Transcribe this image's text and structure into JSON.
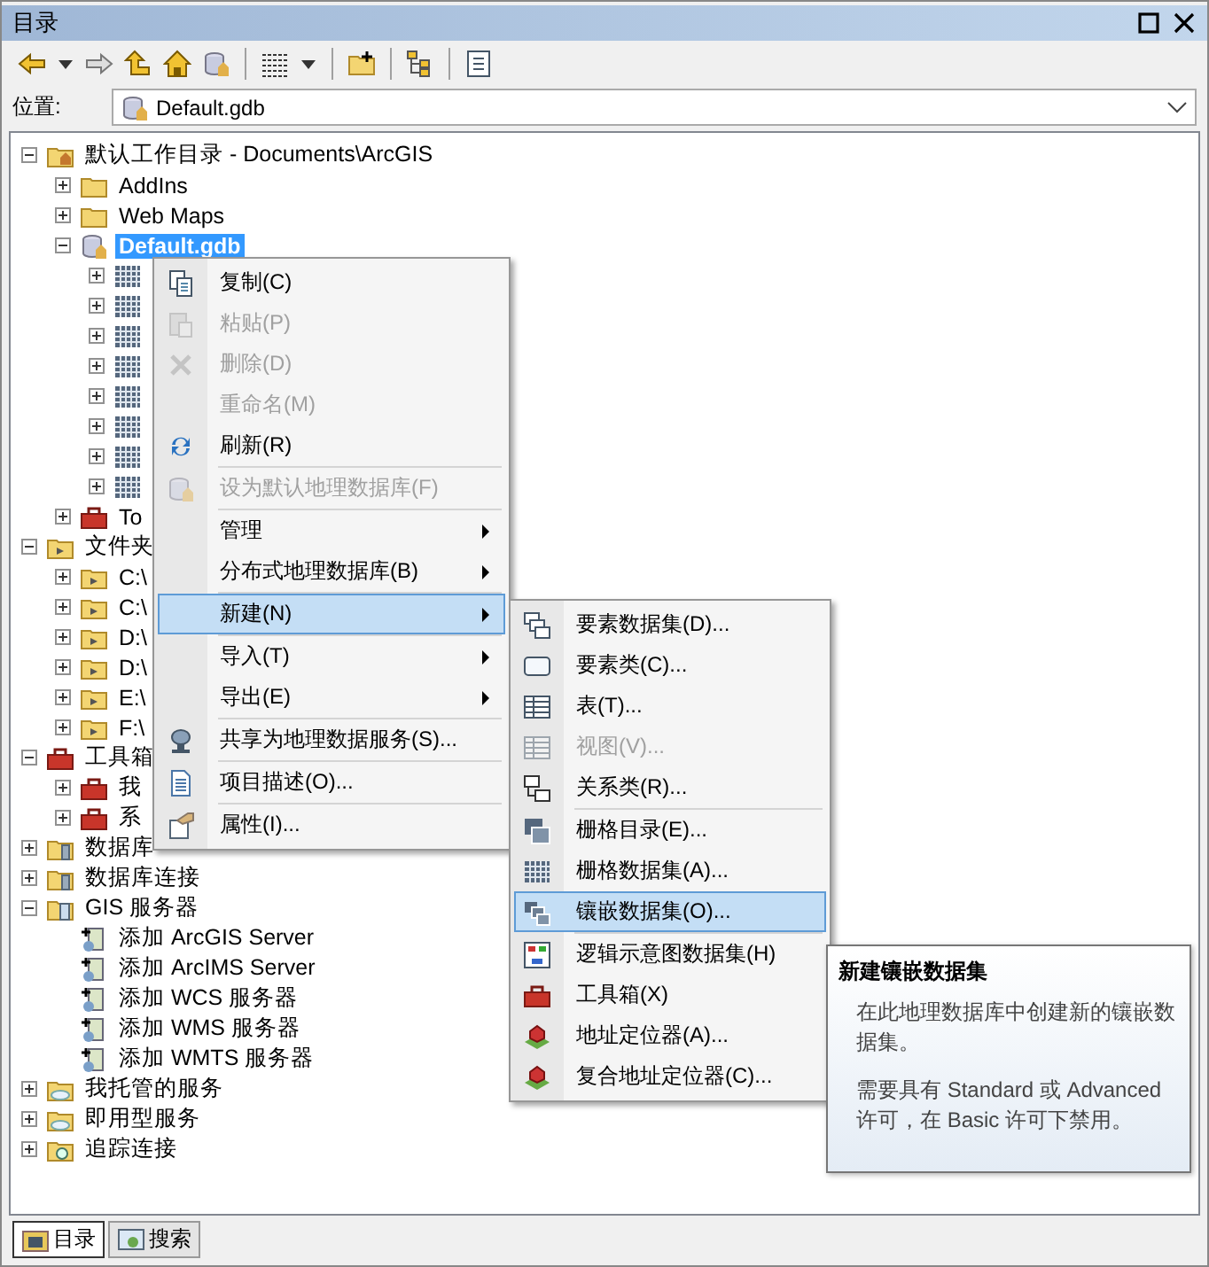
{
  "window": {
    "title": "目录"
  },
  "toolbar": {
    "buttons": [
      {
        "kind": "back"
      },
      {
        "kind": "dropdown"
      },
      {
        "kind": "forward"
      },
      {
        "kind": "up"
      },
      {
        "kind": "home"
      },
      {
        "kind": "gdb"
      },
      {
        "kind": "separator"
      },
      {
        "kind": "grid"
      },
      {
        "kind": "dropdown"
      },
      {
        "kind": "separator"
      },
      {
        "kind": "connect"
      },
      {
        "kind": "separator"
      },
      {
        "kind": "tree"
      },
      {
        "kind": "separator"
      },
      {
        "kind": "list"
      }
    ]
  },
  "location": {
    "label": "位置:",
    "value": "Default.gdb"
  },
  "tree": [
    {
      "label": "默认工作目录 - Documents\\ArcGIS",
      "kind": "home-folder",
      "expanded": true,
      "selected": false,
      "children": [
        {
          "label": "AddIns",
          "kind": "folder",
          "expanded": false,
          "selected": false
        },
        {
          "label": "Web Maps",
          "kind": "folder",
          "expanded": false,
          "selected": false
        },
        {
          "label": "Default.gdb",
          "kind": "gdb",
          "expanded": true,
          "selected": true,
          "children": [
            {
              "kind": "raster",
              "expanded": false
            },
            {
              "kind": "raster",
              "expanded": false
            },
            {
              "kind": "raster",
              "expanded": false
            },
            {
              "kind": "raster",
              "expanded": false
            },
            {
              "kind": "raster",
              "expanded": false
            },
            {
              "kind": "raster",
              "expanded": false
            },
            {
              "kind": "raster",
              "expanded": false
            },
            {
              "kind": "raster",
              "expanded": false
            }
          ]
        },
        {
          "label": "To",
          "kind": "toolbox",
          "expanded": false,
          "selected": false
        }
      ]
    },
    {
      "label": "文件夹",
      "kind": "folder-link",
      "expanded": true,
      "selected": false,
      "children": [
        {
          "label": "C:\\",
          "kind": "folder-link",
          "expanded": false,
          "selected": false
        },
        {
          "label": "C:\\",
          "kind": "folder-link",
          "expanded": false,
          "selected": false
        },
        {
          "label": "D:\\",
          "kind": "folder-link",
          "expanded": false,
          "selected": false
        },
        {
          "label": "D:\\",
          "kind": "folder-link",
          "expanded": false,
          "selected": false
        },
        {
          "label": "E:\\",
          "kind": "folder-link",
          "expanded": false,
          "selected": false
        },
        {
          "label": "F:\\",
          "kind": "folder-link",
          "expanded": false,
          "selected": false
        }
      ]
    },
    {
      "label": "工具箱",
      "kind": "toolbox",
      "expanded": true,
      "selected": false,
      "children": [
        {
          "label": "我",
          "kind": "toolbox",
          "expanded": false,
          "selected": false
        },
        {
          "label": "系",
          "kind": "toolbox",
          "expanded": false,
          "selected": false
        }
      ]
    },
    {
      "label": "数据库",
      "kind": "db-folder",
      "expanded": false,
      "selected": false
    },
    {
      "label": "数据库连接",
      "kind": "db-folder",
      "expanded": false,
      "selected": false
    },
    {
      "label": "GIS 服务器",
      "kind": "server-folder",
      "expanded": true,
      "selected": false,
      "children": [
        {
          "label": "添加 ArcGIS Server",
          "kind": "server-add",
          "selected": false
        },
        {
          "label": "添加 ArcIMS Server",
          "kind": "server-add",
          "selected": false
        },
        {
          "label": "添加 WCS 服务器",
          "kind": "server-add",
          "selected": false
        },
        {
          "label": "添加 WMS 服务器",
          "kind": "server-add",
          "selected": false
        },
        {
          "label": "添加 WMTS 服务器",
          "kind": "server-add",
          "selected": false
        }
      ]
    },
    {
      "label": "我托管的服务",
      "kind": "cloud-folder",
      "expanded": false,
      "selected": false
    },
    {
      "label": "即用型服务",
      "kind": "cloud-folder",
      "expanded": false,
      "selected": false
    },
    {
      "label": "追踪连接",
      "kind": "tracking-folder",
      "expanded": false,
      "selected": false
    }
  ],
  "context_menu": {
    "items": [
      {
        "kind": "copy",
        "label": "复制(C)",
        "disabled": false,
        "selected": false
      },
      {
        "kind": "paste",
        "label": "粘贴(P)",
        "disabled": true,
        "selected": false
      },
      {
        "kind": "delete",
        "label": "删除(D)",
        "disabled": true,
        "selected": false
      },
      {
        "kind": "plain",
        "label": "重命名(M)",
        "disabled": true,
        "selected": false
      },
      {
        "kind": "refresh",
        "label": "刷新(R)",
        "disabled": false,
        "selected": false
      },
      {
        "kind": "separator"
      },
      {
        "kind": "gdb",
        "label": "设为默认地理数据库(F)",
        "disabled": true,
        "selected": false
      },
      {
        "kind": "separator"
      },
      {
        "kind": "submenu",
        "label": "管理",
        "disabled": false,
        "selected": false
      },
      {
        "kind": "submenu",
        "label": "分布式地理数据库(B)",
        "disabled": false,
        "selected": false
      },
      {
        "kind": "separator"
      },
      {
        "kind": "submenu",
        "label": "新建(N)",
        "disabled": false,
        "selected": true
      },
      {
        "kind": "separator"
      },
      {
        "kind": "submenu",
        "label": "导入(T)",
        "disabled": false,
        "selected": false
      },
      {
        "kind": "submenu",
        "label": "导出(E)",
        "disabled": false,
        "selected": false
      },
      {
        "kind": "separator"
      },
      {
        "kind": "server",
        "label": "共享为地理数据服务(S)...",
        "disabled": false,
        "selected": false
      },
      {
        "kind": "separator"
      },
      {
        "kind": "document",
        "label": "项目描述(O)...",
        "disabled": false,
        "selected": false
      },
      {
        "kind": "separator"
      },
      {
        "kind": "properties",
        "label": "属性(I)...",
        "disabled": false,
        "selected": false
      }
    ]
  },
  "submenu": {
    "items": [
      {
        "kind": "dataset",
        "label": "要素数据集(D)...",
        "disabled": false,
        "selected": false
      },
      {
        "kind": "feature-class",
        "label": "要素类(C)...",
        "disabled": false,
        "selected": false
      },
      {
        "kind": "table",
        "label": "表(T)...",
        "disabled": false,
        "selected": false
      },
      {
        "kind": "table",
        "label": "视图(V)...",
        "disabled": true,
        "selected": false
      },
      {
        "kind": "relationship",
        "label": "关系类(R)...",
        "disabled": false,
        "selected": false
      },
      {
        "kind": "separator"
      },
      {
        "kind": "raster-catalog",
        "label": "栅格目录(E)...",
        "disabled": false,
        "selected": false
      },
      {
        "kind": "raster",
        "label": "栅格数据集(A)...",
        "disabled": false,
        "selected": false
      },
      {
        "kind": "mosaic",
        "label": "镶嵌数据集(O)...",
        "disabled": false,
        "selected": true
      },
      {
        "kind": "separator"
      },
      {
        "kind": "schematic",
        "label": "逻辑示意图数据集(H)",
        "disabled": false,
        "selected": false
      },
      {
        "kind": "toolbox",
        "label": "工具箱(X)",
        "disabled": false,
        "selected": false
      },
      {
        "kind": "locator",
        "label": "地址定位器(A)...",
        "disabled": false,
        "selected": false
      },
      {
        "kind": "locator",
        "label": "复合地址定位器(C)...",
        "disabled": false,
        "selected": false
      }
    ]
  },
  "tooltip": {
    "title": "新建镶嵌数据集",
    "paragraphs": [
      "在此地理数据库中创建新的镶嵌数据集。",
      "需要具有 Standard 或 Advanced 许可，在 Basic 许可下禁用。"
    ]
  },
  "bottom_tabs": [
    {
      "label": "目录",
      "selected": true
    },
    {
      "label": "搜索",
      "selected": false
    }
  ]
}
